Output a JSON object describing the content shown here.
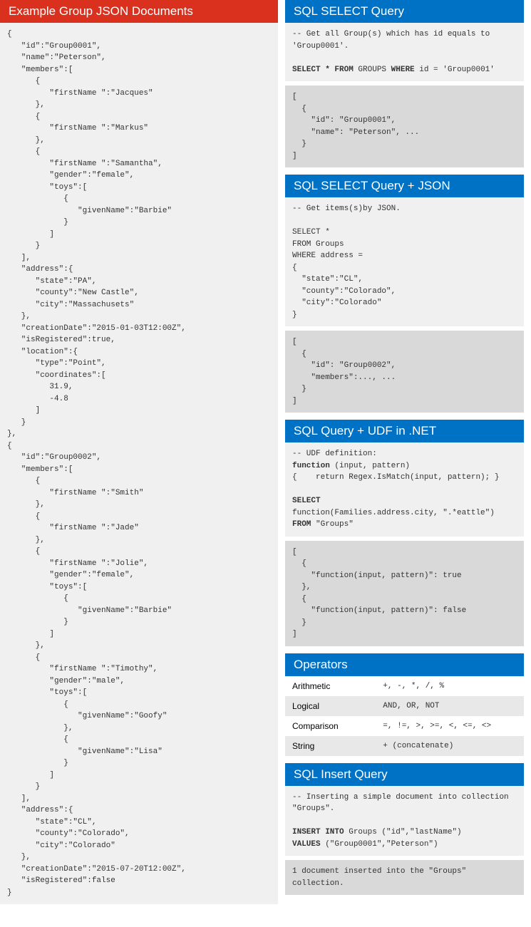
{
  "left": {
    "title": "Example Group JSON Documents",
    "code": "{\n   \"id\":\"Group0001\",\n   \"name\":\"Peterson\",\n   \"members\":[\n      {\n         \"firstName \":\"Jacques\"\n      },\n      {\n         \"firstName \":\"Markus\"\n      },\n      {\n         \"firstName \":\"Samantha\",\n         \"gender\":\"female\",\n         \"toys\":[\n            {\n               \"givenName\":\"Barbie\"\n            }\n         ]\n      }\n   ],\n   \"address\":{\n      \"state\":\"PA\",\n      \"county\":\"New Castle\",\n      \"city\":\"Massachusets\"\n   },\n   \"creationDate\":\"2015-01-03T12:00Z\",\n   \"isRegistered\":true,\n   \"location\":{\n      \"type\":\"Point\",\n      \"coordinates\":[\n         31.9,\n         -4.8\n      ]\n   }\n},\n{\n   \"id\":\"Group0002\",\n   \"members\":[\n      {\n         \"firstName \":\"Smith\"\n      },\n      {\n         \"firstName \":\"Jade\"\n      },\n      {\n         \"firstName \":\"Jolie\",\n         \"gender\":\"female\",\n         \"toys\":[\n            {\n               \"givenName\":\"Barbie\"\n            }\n         ]\n      },\n      {\n         \"firstName \":\"Timothy\",\n         \"gender\":\"male\",\n         \"toys\":[\n            {\n               \"givenName\":\"Goofy\"\n            },\n            {\n               \"givenName\":\"Lisa\"\n            }\n         ]\n      }\n   ],\n   \"address\":{\n      \"state\":\"CL\",\n      \"county\":\"Colorado\",\n      \"city\":\"Colorado\"\n   },\n   \"creationDate\":\"2015-07-20T12:00Z\",\n   \"isRegistered\":false\n}"
  },
  "select": {
    "title": "SQL SELECT Query",
    "comment": "-- Get all Group(s) which has id equals to\n'Group0001'.",
    "query_html": "<span class='kw'>SELECT * FROM</span> GROUPS <span class='kw'>WHERE</span> id = 'Group0001'",
    "result": "[\n  {\n    \"id\": \"Group0001\",\n    \"name\": \"Peterson\", ...\n  }\n]"
  },
  "selectjson": {
    "title": "SQL SELECT Query + JSON",
    "comment": "-- Get items(s)by JSON.",
    "query": "SELECT *\nFROM Groups\nWHERE address =\n{\n  \"state\":\"CL\",\n  \"county\":\"Colorado\",\n  \"city\":\"Colorado\"\n}",
    "result": "[\n  {\n    \"id\": \"Group0002\",\n    \"members\":..., ...\n  }\n]"
  },
  "udf": {
    "title": "SQL Query + UDF in .NET",
    "code_html": "-- UDF definition:\n<span class='kw'>function</span> (input, pattern)\n{    return Regex.IsMatch(input, pattern); }\n\n<span class='kw'>SELECT</span>\nfunction(Families.address.city, \".*eattle\")\n<span class='kw'>FROM</span> \"Groups\"",
    "result": "[\n  {\n    \"function(input, pattern)\": true\n  },\n  {\n    \"function(input, pattern)\": false\n  }\n]"
  },
  "operators": {
    "title": "Operators",
    "rows": [
      {
        "label": "Arithmetic",
        "val": "+, -, *, /, %"
      },
      {
        "label": "Logical",
        "val": "AND, OR, NOT"
      },
      {
        "label": "Comparison",
        "val": "=, !=, >, >=, <, <=, <>"
      },
      {
        "label": "String",
        "val": "+ (concatenate)"
      }
    ]
  },
  "insert": {
    "title": "SQL Insert Query",
    "comment": "-- Inserting a simple document into collection\n\"Groups\".",
    "query_html": "<span class='kw'>INSERT INTO</span> Groups (\"id\",\"lastName\")\n<span class='kw'>VALUES</span> (\"Group0001\",\"Peterson\")",
    "result": "1 document inserted into the \"Groups\"\ncollection."
  }
}
